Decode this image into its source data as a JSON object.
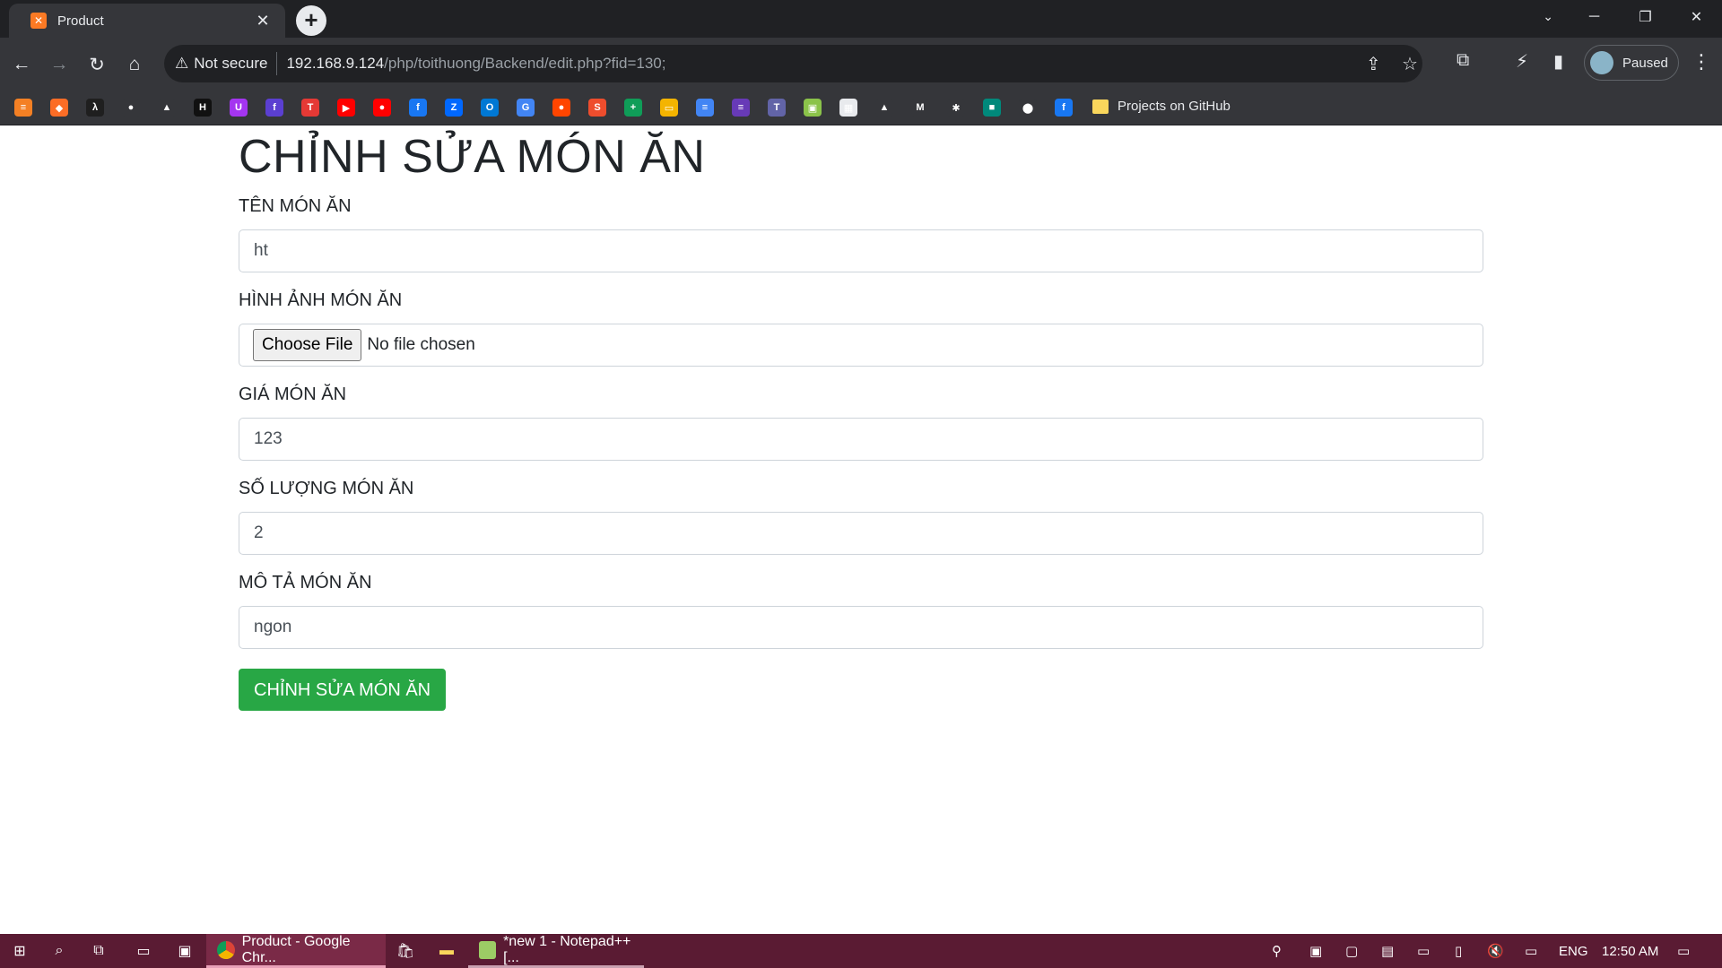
{
  "browser": {
    "tab_title": "Product",
    "tab_favicon": "xampp-icon",
    "profile_label": "Paused",
    "security_label": "Not secure",
    "url_host": "192.168.9.124",
    "url_path": "/php/toithuong/Backend/edit.php?fid=130;",
    "bookmark_folder": "Projects on GitHub",
    "bookmarks": [
      {
        "icon": "stackoverflow-icon",
        "color": "#f48024",
        "glyph": "≡"
      },
      {
        "icon": "gitlab-icon",
        "color": "#fc6d26",
        "glyph": "◆"
      },
      {
        "icon": "devdocs-icon",
        "color": "#1f1f1f",
        "glyph": "λ"
      },
      {
        "icon": "github-icon",
        "color": "#35363a",
        "glyph": "●"
      },
      {
        "icon": "vercel-icon",
        "color": "#35363a",
        "glyph": "▲"
      },
      {
        "icon": "hackerrank-icon",
        "color": "#111",
        "glyph": "H"
      },
      {
        "icon": "udemy-icon",
        "color": "#a435f0",
        "glyph": "U"
      },
      {
        "icon": "feather-icon",
        "color": "#5b3fd1",
        "glyph": "f"
      },
      {
        "icon": "t-icon",
        "color": "#e53935",
        "glyph": "T"
      },
      {
        "icon": "youtube-icon",
        "color": "#ff0000",
        "glyph": "▶"
      },
      {
        "icon": "youtube-music-icon",
        "color": "#ff0000",
        "glyph": "●"
      },
      {
        "icon": "facebook-icon",
        "color": "#1877f2",
        "glyph": "f"
      },
      {
        "icon": "zalo-icon",
        "color": "#0068ff",
        "glyph": "Z"
      },
      {
        "icon": "outlook-icon",
        "color": "#0078d4",
        "glyph": "O"
      },
      {
        "icon": "translate-icon",
        "color": "#4285f4",
        "glyph": "G"
      },
      {
        "icon": "reddit-icon",
        "color": "#ff4500",
        "glyph": "●"
      },
      {
        "icon": "shopee-icon",
        "color": "#ee4d2d",
        "glyph": "S"
      },
      {
        "icon": "sheets-icon",
        "color": "#0f9d58",
        "glyph": "+"
      },
      {
        "icon": "slides-icon",
        "color": "#f4b400",
        "glyph": "▭"
      },
      {
        "icon": "docs-icon",
        "color": "#4285f4",
        "glyph": "≡"
      },
      {
        "icon": "forms-icon",
        "color": "#673ab7",
        "glyph": "≡"
      },
      {
        "icon": "teams-icon",
        "color": "#6264a7",
        "glyph": "T"
      },
      {
        "icon": "photos-frame-icon",
        "color": "#8bc34a",
        "glyph": "▣"
      },
      {
        "icon": "store-icon",
        "color": "#e8eaed",
        "glyph": "▦"
      },
      {
        "icon": "drive-icon",
        "color": "#35363a",
        "glyph": "▲"
      },
      {
        "icon": "gmail-icon",
        "color": "#35363a",
        "glyph": "M"
      },
      {
        "icon": "photos-icon",
        "color": "#35363a",
        "glyph": "✱"
      },
      {
        "icon": "meet-icon",
        "color": "#00897b",
        "glyph": "■"
      },
      {
        "icon": "maps-icon",
        "color": "#35363a",
        "glyph": "⬤"
      },
      {
        "icon": "facebook-square-icon",
        "color": "#1877f2",
        "glyph": "f"
      }
    ]
  },
  "page": {
    "title": "CHỈNH SỬA MÓN ĂN",
    "fields": {
      "name_label": "TÊN MÓN ĂN",
      "name_value": "ht",
      "image_label": "HÌNH ẢNH MÓN ĂN",
      "file_button": "Choose File",
      "file_status": "No file chosen",
      "price_label": "GIÁ MÓN ĂN",
      "price_value": "123",
      "qty_label": "SỐ LƯỢNG MÓN ĂN",
      "qty_value": "2",
      "desc_label": "MÔ TẢ MÓN ĂN",
      "desc_value": "ngon"
    },
    "submit_label": "CHỈNH SỬA MÓN ĂN",
    "submit_color": "#28a745"
  },
  "taskbar": {
    "apps": [
      {
        "label": "Product - Google Chr...",
        "icon": "chrome-icon"
      },
      {
        "label": "*new 1 - Notepad++ [...",
        "icon": "notepadpp-icon"
      }
    ],
    "language": "ENG",
    "time": "12:50 AM",
    "color": "#5a1b33"
  }
}
